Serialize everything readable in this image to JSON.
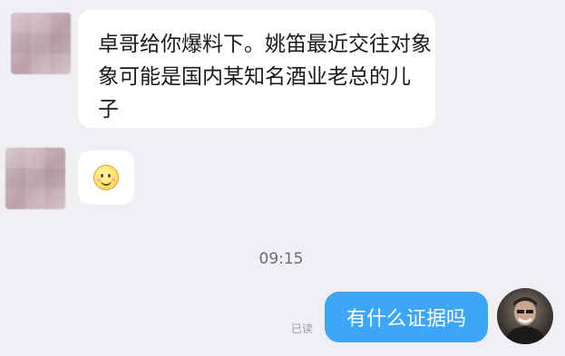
{
  "chat": {
    "messages": [
      {
        "sender": "other",
        "text": "卓哥给你爆料下。姚笛最近交往对象可能是国内某知名酒业老总的儿子",
        "line1": "卓哥给你爆料下。姚笛最近交往对象",
        "line2": "可能是国内某知名酒业老总的儿子",
        "line3": "子"
      },
      {
        "sender": "other",
        "emoji": "smile-emoji"
      },
      {
        "sender": "me",
        "text": "有什么证据吗",
        "status": "已读"
      }
    ],
    "timestamp": "09:15"
  },
  "colors": {
    "background": "#efeff4",
    "incoming_bubble": "#ffffff",
    "outgoing_bubble": "#3ea6f6"
  }
}
